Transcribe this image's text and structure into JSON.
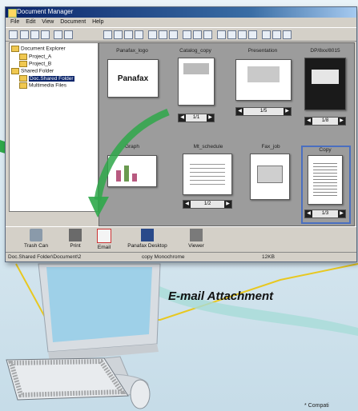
{
  "window": {
    "title": "Document Manager",
    "menu": [
      "File",
      "Edit",
      "View",
      "Document",
      "Help"
    ]
  },
  "tree": {
    "items": [
      {
        "label": "Document Explorer",
        "level": 0
      },
      {
        "label": "Project_A",
        "level": 1
      },
      {
        "label": "Project_B",
        "level": 1
      },
      {
        "label": "Shared Folder",
        "level": 0
      },
      {
        "label": "Doc.Shared Folder",
        "level": 1,
        "selected": true
      },
      {
        "label": "Multimedia Files",
        "level": 1
      }
    ]
  },
  "documents": [
    {
      "name": "Panafax_logo",
      "logo_text": "Panafax"
    },
    {
      "name": "Catalog_copy",
      "pages": "1/1"
    },
    {
      "name": "Presentation",
      "pages": "1/5"
    },
    {
      "name": "DP/8xx/8015",
      "pages": "1/8"
    },
    {
      "name": "Graph"
    },
    {
      "name": "Mt_schedule",
      "pages": "1/2"
    },
    {
      "name": "Fax_job"
    },
    {
      "name": "Copy",
      "pages": "1/3"
    }
  ],
  "tray": {
    "items": [
      {
        "label": "Trash Can",
        "icon": "trash-icon"
      },
      {
        "label": "Print",
        "icon": "printer-icon"
      },
      {
        "label": "Email",
        "icon": "email-icon"
      },
      {
        "label": "Panafax Desktop",
        "icon": "desktop-icon"
      },
      {
        "label": "Viewer",
        "icon": "viewer-icon"
      }
    ]
  },
  "status": {
    "path": "Doc.Shared Folder\\Document\\2",
    "doc_label": "copy  Monochrome",
    "size": "12KB"
  },
  "caption": "E-mail Attachment",
  "footnote": "* Compati",
  "colors": {
    "title_bar": "#0a246a",
    "arrow_green": "#2fa84a",
    "accent_yellow": "#f0d020"
  }
}
